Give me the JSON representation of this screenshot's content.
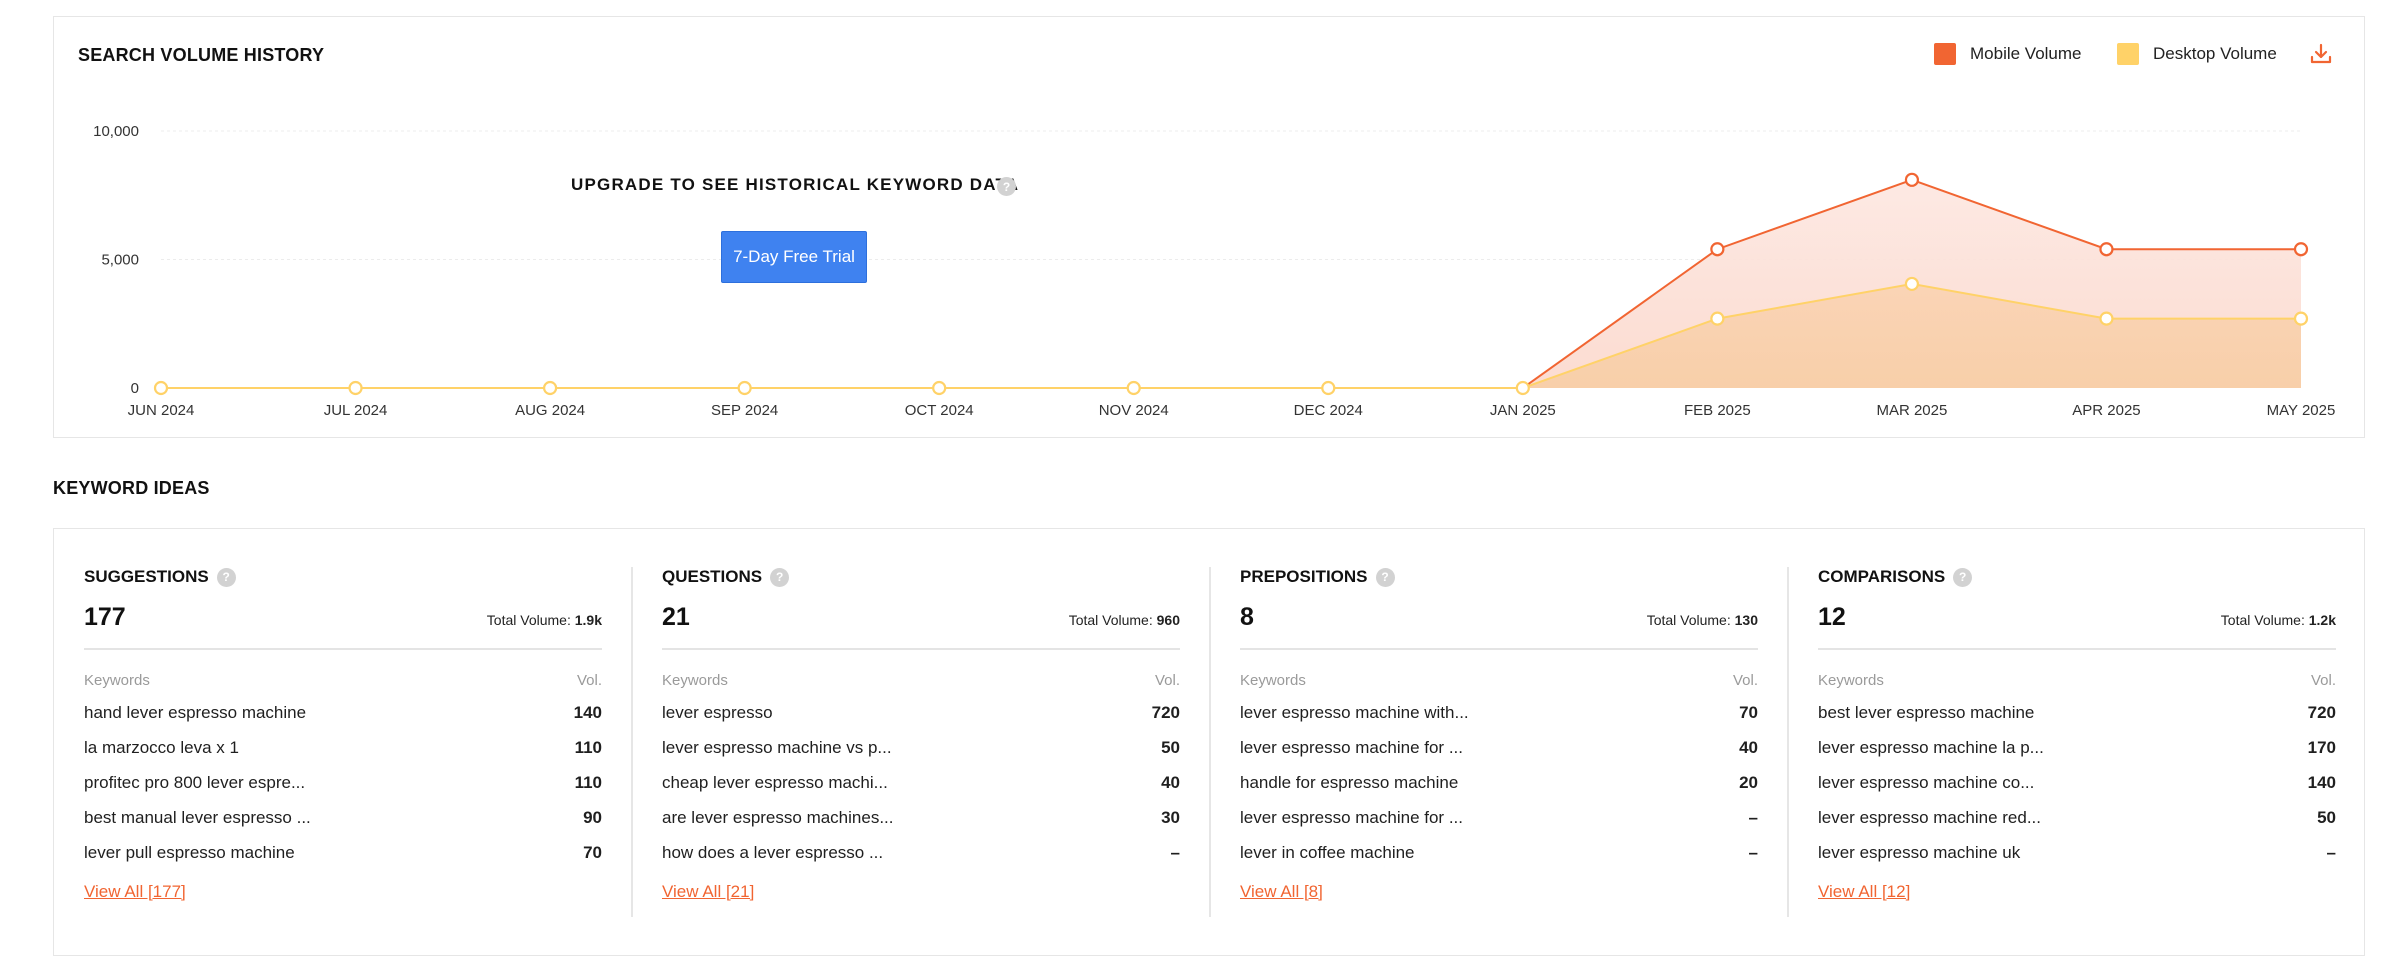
{
  "chart_section": {
    "title": "SEARCH VOLUME HISTORY",
    "legend": {
      "mobile_label": "Mobile Volume",
      "desktop_label": "Desktop Volume",
      "mobile_color": "#f16532",
      "desktop_color": "#ffd268"
    },
    "download_icon": "download-icon",
    "upgrade_text": "UPGRADE TO SEE HISTORICAL KEYWORD DATA",
    "trial_button": "7-Day Free Trial"
  },
  "chart_data": {
    "type": "area",
    "x": [
      "JUN 2024",
      "JUL 2024",
      "AUG 2024",
      "SEP 2024",
      "OCT 2024",
      "NOV 2024",
      "DEC 2024",
      "JAN 2025",
      "FEB 2025",
      "MAR 2025",
      "APR 2025",
      "MAY 2025"
    ],
    "y_ticks": [
      "0",
      "5,000",
      "10,000"
    ],
    "ylim": [
      0,
      10000
    ],
    "grid": true,
    "legend_position": "top-right",
    "series": [
      {
        "name": "Mobile Volume",
        "color": "#f16532",
        "values": [
          0,
          0,
          0,
          0,
          0,
          0,
          0,
          0,
          5400,
          8100,
          5400,
          5400
        ]
      },
      {
        "name": "Desktop Volume",
        "color": "#ffd268",
        "values": [
          0,
          0,
          0,
          0,
          0,
          0,
          0,
          0,
          2700,
          4050,
          2700,
          2700
        ]
      }
    ]
  },
  "ideas_section": {
    "title": "KEYWORD IDEAS",
    "keywords_header": "Keywords",
    "vol_header": "Vol.",
    "total_label": "Total Volume:",
    "columns": [
      {
        "name": "SUGGESTIONS",
        "count": "177",
        "total": "1.9k",
        "view_all": "View All [177]",
        "rows": [
          {
            "kw": "hand lever espresso machine",
            "vol": "140"
          },
          {
            "kw": "la marzocco leva x 1",
            "vol": "110"
          },
          {
            "kw": "profitec pro 800 lever espre...",
            "vol": "110"
          },
          {
            "kw": "best manual lever espresso ...",
            "vol": "90"
          },
          {
            "kw": "lever pull espresso machine",
            "vol": "70"
          }
        ]
      },
      {
        "name": "QUESTIONS",
        "count": "21",
        "total": "960",
        "view_all": "View All [21]",
        "rows": [
          {
            "kw": "lever espresso",
            "vol": "720"
          },
          {
            "kw": "lever espresso machine vs p...",
            "vol": "50"
          },
          {
            "kw": "cheap lever espresso machi...",
            "vol": "40"
          },
          {
            "kw": "are lever espresso machines...",
            "vol": "30"
          },
          {
            "kw": "how does a lever espresso ...",
            "vol": "–"
          }
        ]
      },
      {
        "name": "PREPOSITIONS",
        "count": "8",
        "total": "130",
        "view_all": "View All [8]",
        "rows": [
          {
            "kw": "lever espresso machine with...",
            "vol": "70"
          },
          {
            "kw": "lever espresso machine for ...",
            "vol": "40"
          },
          {
            "kw": "handle for espresso machine",
            "vol": "20"
          },
          {
            "kw": "lever espresso machine for ...",
            "vol": "–"
          },
          {
            "kw": "lever in coffee machine",
            "vol": "–"
          }
        ]
      },
      {
        "name": "COMPARISONS",
        "count": "12",
        "total": "1.2k",
        "view_all": "View All [12]",
        "rows": [
          {
            "kw": "best lever espresso machine",
            "vol": "720"
          },
          {
            "kw": "lever espresso machine la p...",
            "vol": "170"
          },
          {
            "kw": "lever espresso machine co...",
            "vol": "140"
          },
          {
            "kw": "lever espresso machine red...",
            "vol": "50"
          },
          {
            "kw": "lever espresso machine uk",
            "vol": "–"
          }
        ]
      }
    ]
  }
}
